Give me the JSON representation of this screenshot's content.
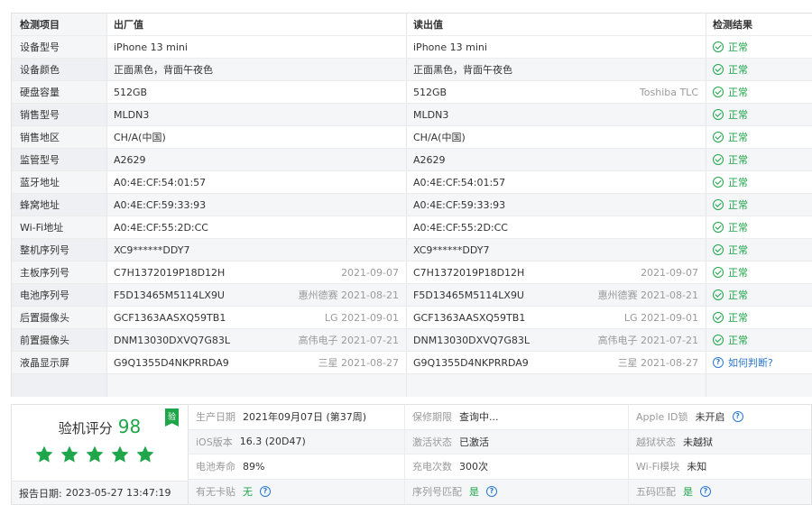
{
  "table": {
    "headers": {
      "item": "检测项目",
      "factory": "出厂值",
      "read": "读出值",
      "result": "检测结果"
    },
    "rows": [
      {
        "name": "设备型号",
        "factory": "iPhone 13 mini",
        "factory_meta": "",
        "read": "iPhone 13 mini",
        "read_meta": "",
        "result": "正常",
        "status": "ok"
      },
      {
        "name": "设备颜色",
        "factory": "正面黑色，背面午夜色",
        "factory_meta": "",
        "read": "正面黑色，背面午夜色",
        "read_meta": "",
        "result": "正常",
        "status": "ok"
      },
      {
        "name": "硬盘容量",
        "factory": "512GB",
        "factory_meta": "",
        "read": "512GB",
        "read_meta": "Toshiba TLC",
        "result": "正常",
        "status": "ok"
      },
      {
        "name": "销售型号",
        "factory": "MLDN3",
        "factory_meta": "",
        "read": "MLDN3",
        "read_meta": "",
        "result": "正常",
        "status": "ok"
      },
      {
        "name": "销售地区",
        "factory": "CH/A(中国)",
        "factory_meta": "",
        "read": "CH/A(中国)",
        "read_meta": "",
        "result": "正常",
        "status": "ok"
      },
      {
        "name": "监管型号",
        "factory": "A2629",
        "factory_meta": "",
        "read": "A2629",
        "read_meta": "",
        "result": "正常",
        "status": "ok"
      },
      {
        "name": "蓝牙地址",
        "factory": "A0:4E:CF:54:01:57",
        "factory_meta": "",
        "read": "A0:4E:CF:54:01:57",
        "read_meta": "",
        "result": "正常",
        "status": "ok"
      },
      {
        "name": "蜂窝地址",
        "factory": "A0:4E:CF:59:33:93",
        "factory_meta": "",
        "read": "A0:4E:CF:59:33:93",
        "read_meta": "",
        "result": "正常",
        "status": "ok"
      },
      {
        "name": "Wi-Fi地址",
        "factory": "A0:4E:CF:55:2D:CC",
        "factory_meta": "",
        "read": "A0:4E:CF:55:2D:CC",
        "read_meta": "",
        "result": "正常",
        "status": "ok"
      },
      {
        "name": "整机序列号",
        "factory": "XC9******DDY7",
        "factory_meta": "",
        "read": "XC9******DDY7",
        "read_meta": "",
        "result": "正常",
        "status": "ok"
      },
      {
        "name": "主板序列号",
        "factory": "C7H1372019P18D12H",
        "factory_meta": "2021-09-07",
        "read": "C7H1372019P18D12H",
        "read_meta": "2021-09-07",
        "result": "正常",
        "status": "ok"
      },
      {
        "name": "电池序列号",
        "factory": "F5D13465M5114LX9U",
        "factory_meta": "惠州德赛 2021-08-21",
        "read": "F5D13465M5114LX9U",
        "read_meta": "惠州德赛 2021-08-21",
        "result": "正常",
        "status": "ok"
      },
      {
        "name": "后置摄像头",
        "factory": "GCF1363AASXQ59TB1",
        "factory_meta": "LG 2021-09-01",
        "read": "GCF1363AASXQ59TB1",
        "read_meta": "LG 2021-09-01",
        "result": "正常",
        "status": "ok"
      },
      {
        "name": "前置摄像头",
        "factory": "DNM13030DXVQ7G83L",
        "factory_meta": "高伟电子 2021-07-21",
        "read": "DNM13030DXVQ7G83L",
        "read_meta": "高伟电子 2021-07-21",
        "result": "正常",
        "status": "ok"
      },
      {
        "name": "液晶显示屏",
        "factory": "G9Q1355D4NKPRRDA9",
        "factory_meta": "三星 2021-08-27",
        "read": "G9Q1355D4NKPRRDA9",
        "read_meta": "三星 2021-08-27",
        "result": "如何判断?",
        "status": "question"
      }
    ]
  },
  "summary": {
    "score_label": "验机评分",
    "score": "98",
    "verify_badge": "验",
    "stars": 5,
    "report_date_label": "报告日期:",
    "report_date": "2023-05-27 13:47:19",
    "info": [
      {
        "label": "生产日期",
        "value": "2021年09月07日 (第37周)",
        "green": false,
        "help": false
      },
      {
        "label": "保修期限",
        "value": "查询中...",
        "green": false,
        "help": false
      },
      {
        "label": "Apple ID锁",
        "value": "未开启",
        "green": false,
        "help": true
      },
      {
        "label": "iOS版本",
        "value": "16.3 (20D47)",
        "green": false,
        "help": false
      },
      {
        "label": "激活状态",
        "value": "已激活",
        "green": false,
        "help": false
      },
      {
        "label": "越狱状态",
        "value": "未越狱",
        "green": false,
        "help": false
      },
      {
        "label": "电池寿命",
        "value": "89%",
        "green": false,
        "help": false
      },
      {
        "label": "充电次数",
        "value": "300次",
        "green": false,
        "help": false
      },
      {
        "label": "Wi-Fi模块",
        "value": "未知",
        "green": false,
        "help": false
      },
      {
        "label": "有无卡贴",
        "value": "无",
        "green": true,
        "help": true
      },
      {
        "label": "序列号匹配",
        "value": "是",
        "green": true,
        "help": true
      },
      {
        "label": "五码匹配",
        "value": "是",
        "green": true,
        "help": true
      }
    ]
  },
  "colors": {
    "ok": "#1fa54a",
    "link": "#2b78d0",
    "alt_row": "#f5f6f8"
  },
  "icons": {
    "ok": "check-circle-icon",
    "question": "question-circle-icon",
    "star": "star-icon",
    "badge": "verify-badge-icon"
  }
}
